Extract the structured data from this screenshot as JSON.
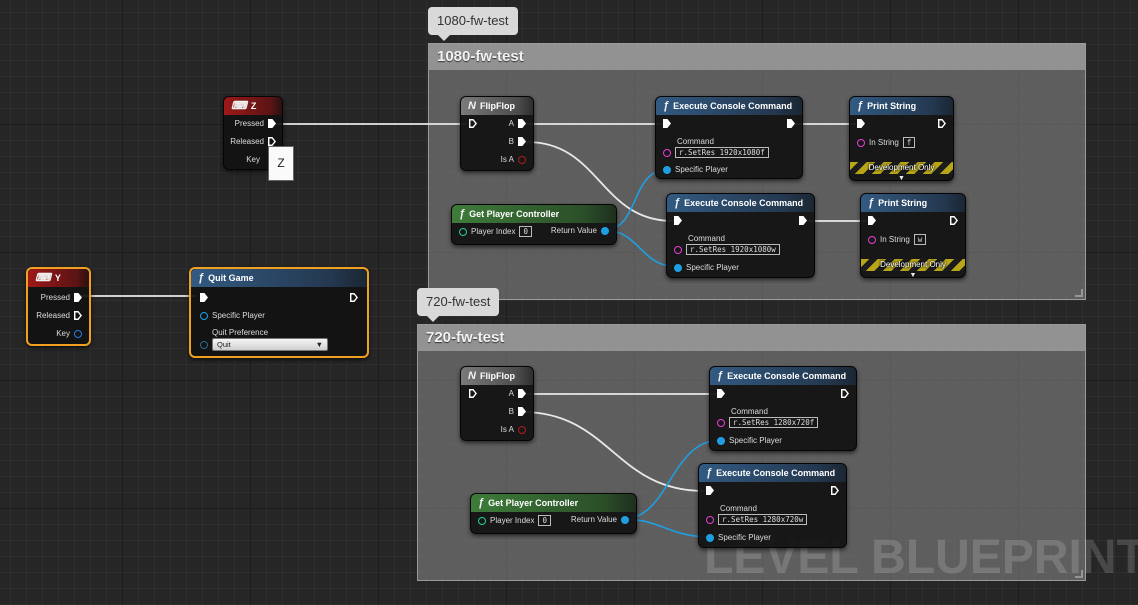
{
  "comments": [
    {
      "bubble": "1080-fw-test",
      "title": "1080-fw-test"
    },
    {
      "bubble": "720-fw-test",
      "title": "720-fw-test"
    }
  ],
  "nodes": {
    "key_z": {
      "title": "Z",
      "pressed": "Pressed",
      "released": "Released",
      "key": "Key",
      "key_value": "Z"
    },
    "key_y": {
      "title": "Y",
      "pressed": "Pressed",
      "released": "Released",
      "key": "Key"
    },
    "quit_game": {
      "title": "Quit Game",
      "specific_player": "Specific Player",
      "quit_preference_label": "Quit Preference",
      "quit_preference_value": "Quit"
    },
    "flipflop_1080": {
      "title": "FlipFlop",
      "a": "A",
      "b": "B",
      "is_a": "Is A"
    },
    "flipflop_720": {
      "title": "FlipFlop",
      "a": "A",
      "b": "B",
      "is_a": "Is A"
    },
    "get_pc_1080": {
      "title": "Get Player Controller",
      "player_index": "Player Index",
      "player_index_value": "0",
      "return_value": "Return Value"
    },
    "get_pc_720": {
      "title": "Get Player Controller",
      "player_index": "Player Index",
      "player_index_value": "0",
      "return_value": "Return Value"
    },
    "exec_1080f": {
      "title": "Execute Console Command",
      "command_label": "Command",
      "command": "r.SetRes 1920x1080f",
      "specific_player": "Specific Player"
    },
    "exec_1080w": {
      "title": "Execute Console Command",
      "command_label": "Command",
      "command": "r.SetRes 1920x1080w",
      "specific_player": "Specific Player"
    },
    "exec_720f": {
      "title": "Execute Console Command",
      "command_label": "Command",
      "command": "r.SetRes 1280x720f",
      "specific_player": "Specific Player"
    },
    "exec_720w": {
      "title": "Execute Console Command",
      "command_label": "Command",
      "command": "r.SetRes 1280x720w",
      "specific_player": "Specific Player"
    },
    "print_f": {
      "title": "Print String",
      "in_string": "In String",
      "value": "f",
      "dev_only": "Development Only"
    },
    "print_w": {
      "title": "Print String",
      "in_string": "In String",
      "value": "w",
      "dev_only": "Development Only"
    }
  },
  "watermark": "LEVEL BLUEPRINT",
  "colors": {
    "exec": "#ffffff",
    "object_pin": "#1f9fe2",
    "string_pin": "#e93cd6",
    "int_pin": "#20d0a0",
    "bool_pin": "#b11c1c",
    "selection": "#f0a020"
  }
}
